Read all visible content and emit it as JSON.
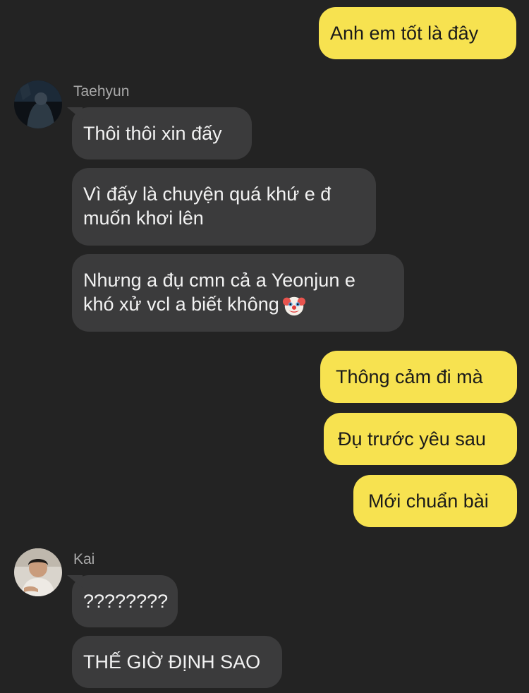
{
  "messages": {
    "m1": "Anh em tốt là đây",
    "m2": "Thôi thôi xin đấy",
    "m3": "Vì đấy là chuyện quá khứ e đ muốn khơi lên",
    "m4": "Nhưng a đụ cmn cả a Yeonjun e khó xử vcl a biết không",
    "m5": "Thông cảm đi mà",
    "m6": "Đụ trước yêu sau",
    "m7": "Mới chuẩn bài",
    "m8": "????????",
    "m9": "THẾ GIỜ ĐỊNH SAO"
  },
  "senders": {
    "taehyun": "Taehyun",
    "kai": "Kai"
  },
  "emoji": {
    "clown": "clown-face-emoji"
  },
  "colors": {
    "background": "#232323",
    "outgoing_bubble": "#f7e250",
    "incoming_bubble": "#3b3b3c",
    "sender_name": "#a9a9a9"
  }
}
